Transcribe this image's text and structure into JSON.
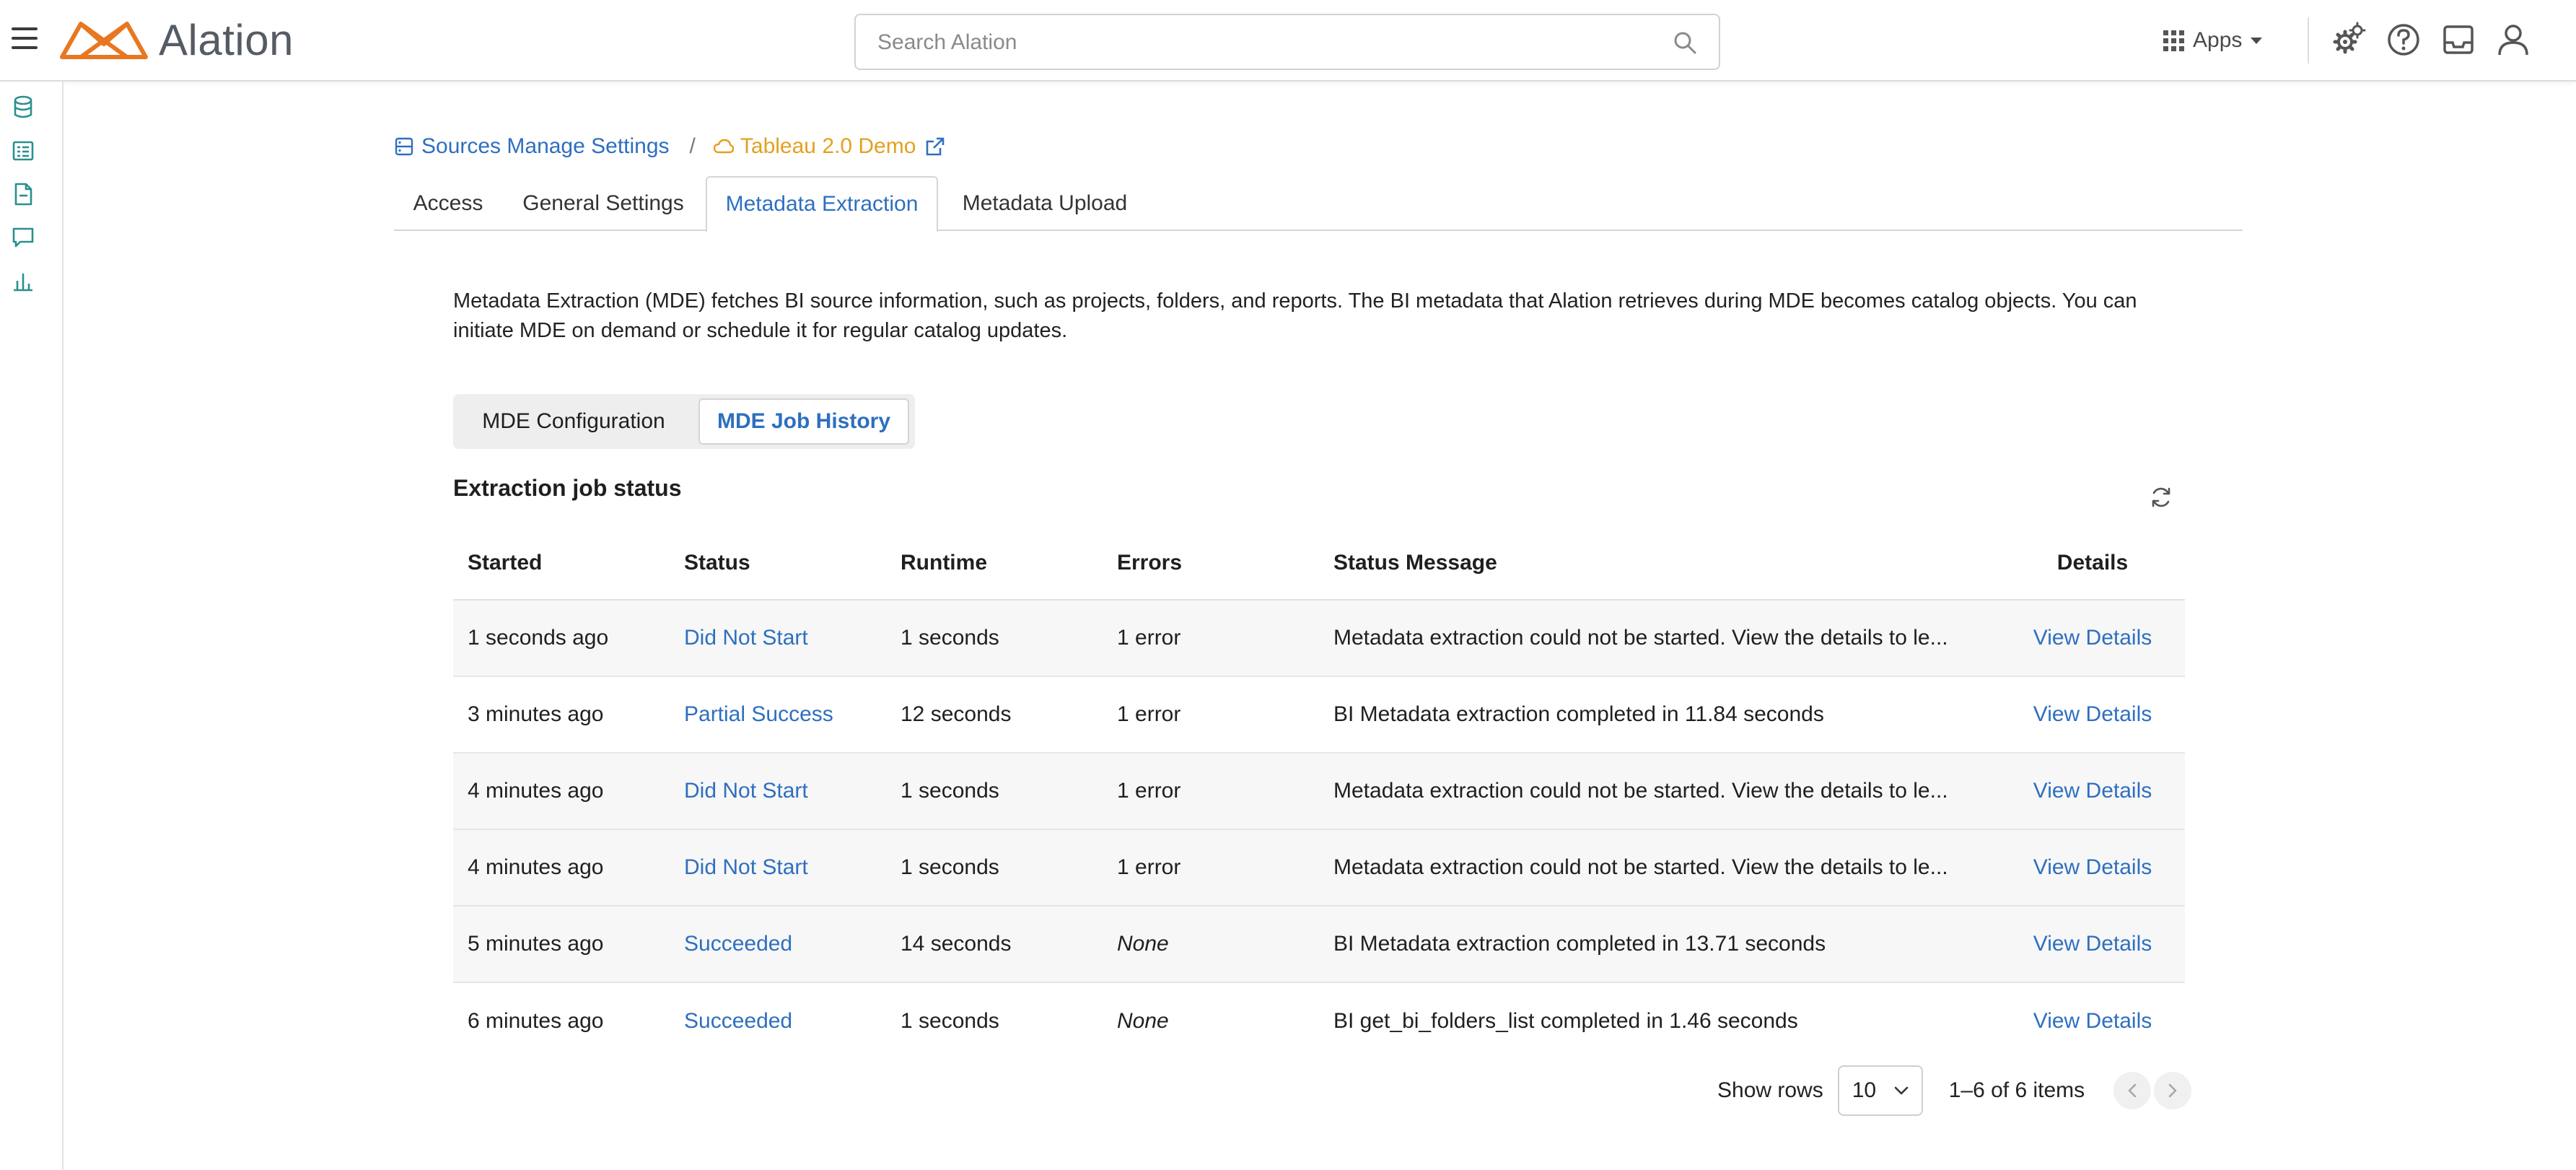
{
  "brand": {
    "name": "Alation",
    "color": "#e87722"
  },
  "search": {
    "placeholder": "Search Alation",
    "value": ""
  },
  "topnav": {
    "apps_label": "Apps"
  },
  "breadcrumb": {
    "sources_label": "Sources Manage Settings",
    "separator": "/",
    "current_label": "Tableau 2.0 Demo"
  },
  "tabs": [
    {
      "label": "Access",
      "active": false
    },
    {
      "label": "General Settings",
      "active": false
    },
    {
      "label": "Metadata Extraction",
      "active": true
    },
    {
      "label": "Metadata Upload",
      "active": false
    }
  ],
  "description": "Metadata Extraction (MDE) fetches BI source information, such as projects, folders, and reports. The BI metadata that Alation retrieves during MDE becomes catalog objects. You can initiate MDE on demand or schedule it for regular catalog updates.",
  "segments": [
    {
      "label": "MDE Configuration",
      "active": false
    },
    {
      "label": "MDE Job History",
      "active": true
    }
  ],
  "section_title": "Extraction job status",
  "table": {
    "columns": [
      "Started",
      "Status",
      "Runtime",
      "Errors",
      "Status Message",
      "Details"
    ],
    "rows": [
      {
        "started": "1 seconds ago",
        "status": "Did Not Start",
        "runtime": "1 seconds",
        "errors": "1 error",
        "message": "Metadata extraction could not be started. View the details to le...",
        "details": "View Details"
      },
      {
        "started": "3 minutes ago",
        "status": "Partial Success",
        "runtime": "12 seconds",
        "errors": "1 error",
        "message": "BI Metadata extraction completed in 11.84 seconds",
        "details": "View Details"
      },
      {
        "started": "4 minutes ago",
        "status": "Did Not Start",
        "runtime": "1 seconds",
        "errors": "1 error",
        "message": "Metadata extraction could not be started. View the details to le...",
        "details": "View Details"
      },
      {
        "started": "4 minutes ago",
        "status": "Did Not Start",
        "runtime": "1 seconds",
        "errors": "1 error",
        "message": "Metadata extraction could not be started. View the details to le...",
        "details": "View Details"
      },
      {
        "started": "5 minutes ago",
        "status": "Succeeded",
        "runtime": "14 seconds",
        "errors": "None",
        "message": "BI Metadata extraction completed in 13.71 seconds",
        "details": "View Details"
      },
      {
        "started": "6 minutes ago",
        "status": "Succeeded",
        "runtime": "1 seconds",
        "errors": "None",
        "message": "BI get_bi_folders_list completed in 1.46 seconds",
        "details": "View Details"
      }
    ]
  },
  "pagination": {
    "show_rows_label": "Show rows",
    "rows_per_page": "10",
    "range_label": "1–6 of 6 items"
  },
  "colors": {
    "link": "#2e6fbf",
    "accent_warning": "#e2a11f",
    "alt_row": "#f7f7f7"
  }
}
